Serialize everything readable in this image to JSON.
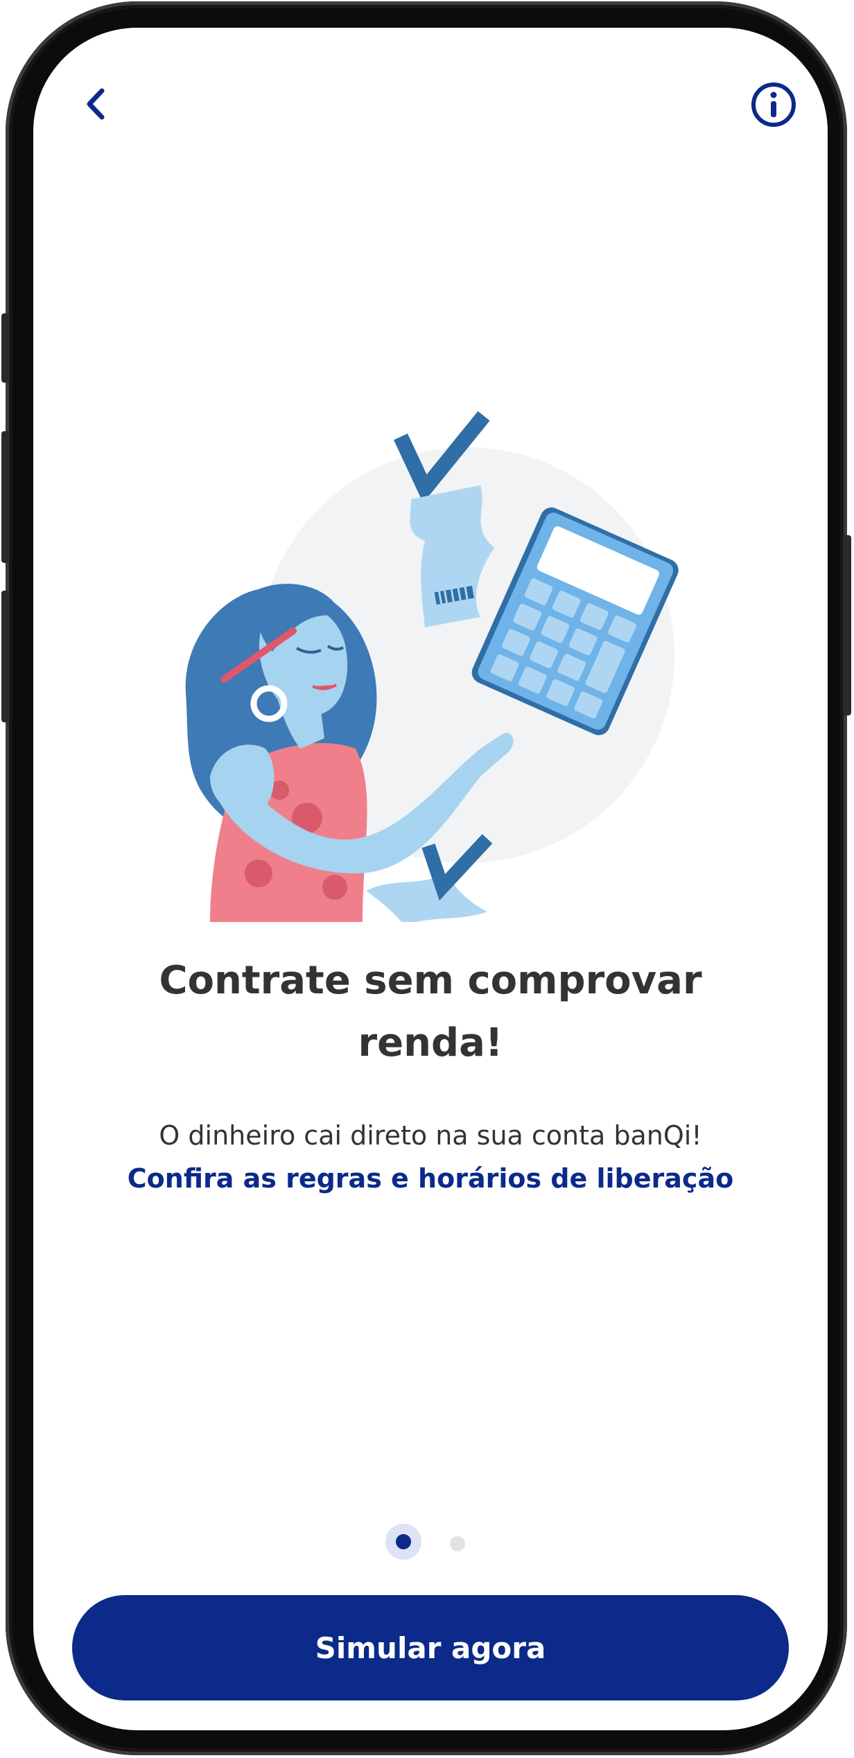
{
  "header": {
    "back_icon": "chevron-left-icon",
    "info_icon": "info-circle-icon"
  },
  "main": {
    "title": "Contrate sem comprovar renda!",
    "subtitle": "O dinheiro cai direto na sua conta banQi!",
    "rules_link": "Confira as regras e horários de liberação"
  },
  "pagination": {
    "total": 2,
    "current": 1
  },
  "cta": {
    "label": "Simular agora"
  },
  "colors": {
    "primary": "#0b2a8a",
    "text": "#333333",
    "dot_inactive": "#e2e2e2",
    "dot_active_ring": "#dde3f4"
  }
}
